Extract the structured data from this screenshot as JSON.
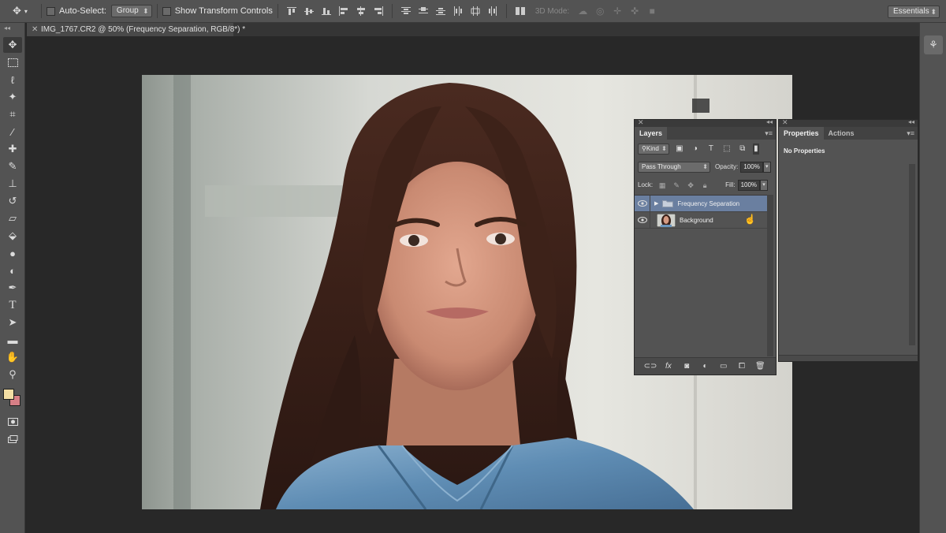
{
  "options_bar": {
    "auto_select_label": "Auto-Select:",
    "auto_select_value": "Group",
    "show_transform_label": "Show Transform Controls",
    "mode_3d_label": "3D Mode:",
    "workspace": "Essentials"
  },
  "document": {
    "tab_title": "IMG_1767.CR2 @ 50% (Frequency Separation, RGB/8*) *"
  },
  "colors": {
    "foreground": "#f3dea4",
    "background": "#d77f86",
    "selection": "#6a7fa0"
  },
  "layers_panel": {
    "tab": "Layers",
    "filter_kind": "Kind",
    "blend_mode": "Pass Through",
    "opacity_label": "Opacity:",
    "opacity_value": "100%",
    "lock_label": "Lock:",
    "fill_label": "Fill:",
    "fill_value": "100%",
    "layers": [
      {
        "name": "Frequency Separation",
        "type": "group",
        "selected": true
      },
      {
        "name": "Background",
        "type": "image",
        "selected": false
      }
    ]
  },
  "properties_panel": {
    "tabs": [
      "Properties",
      "Actions"
    ],
    "empty_text": "No Properties"
  }
}
